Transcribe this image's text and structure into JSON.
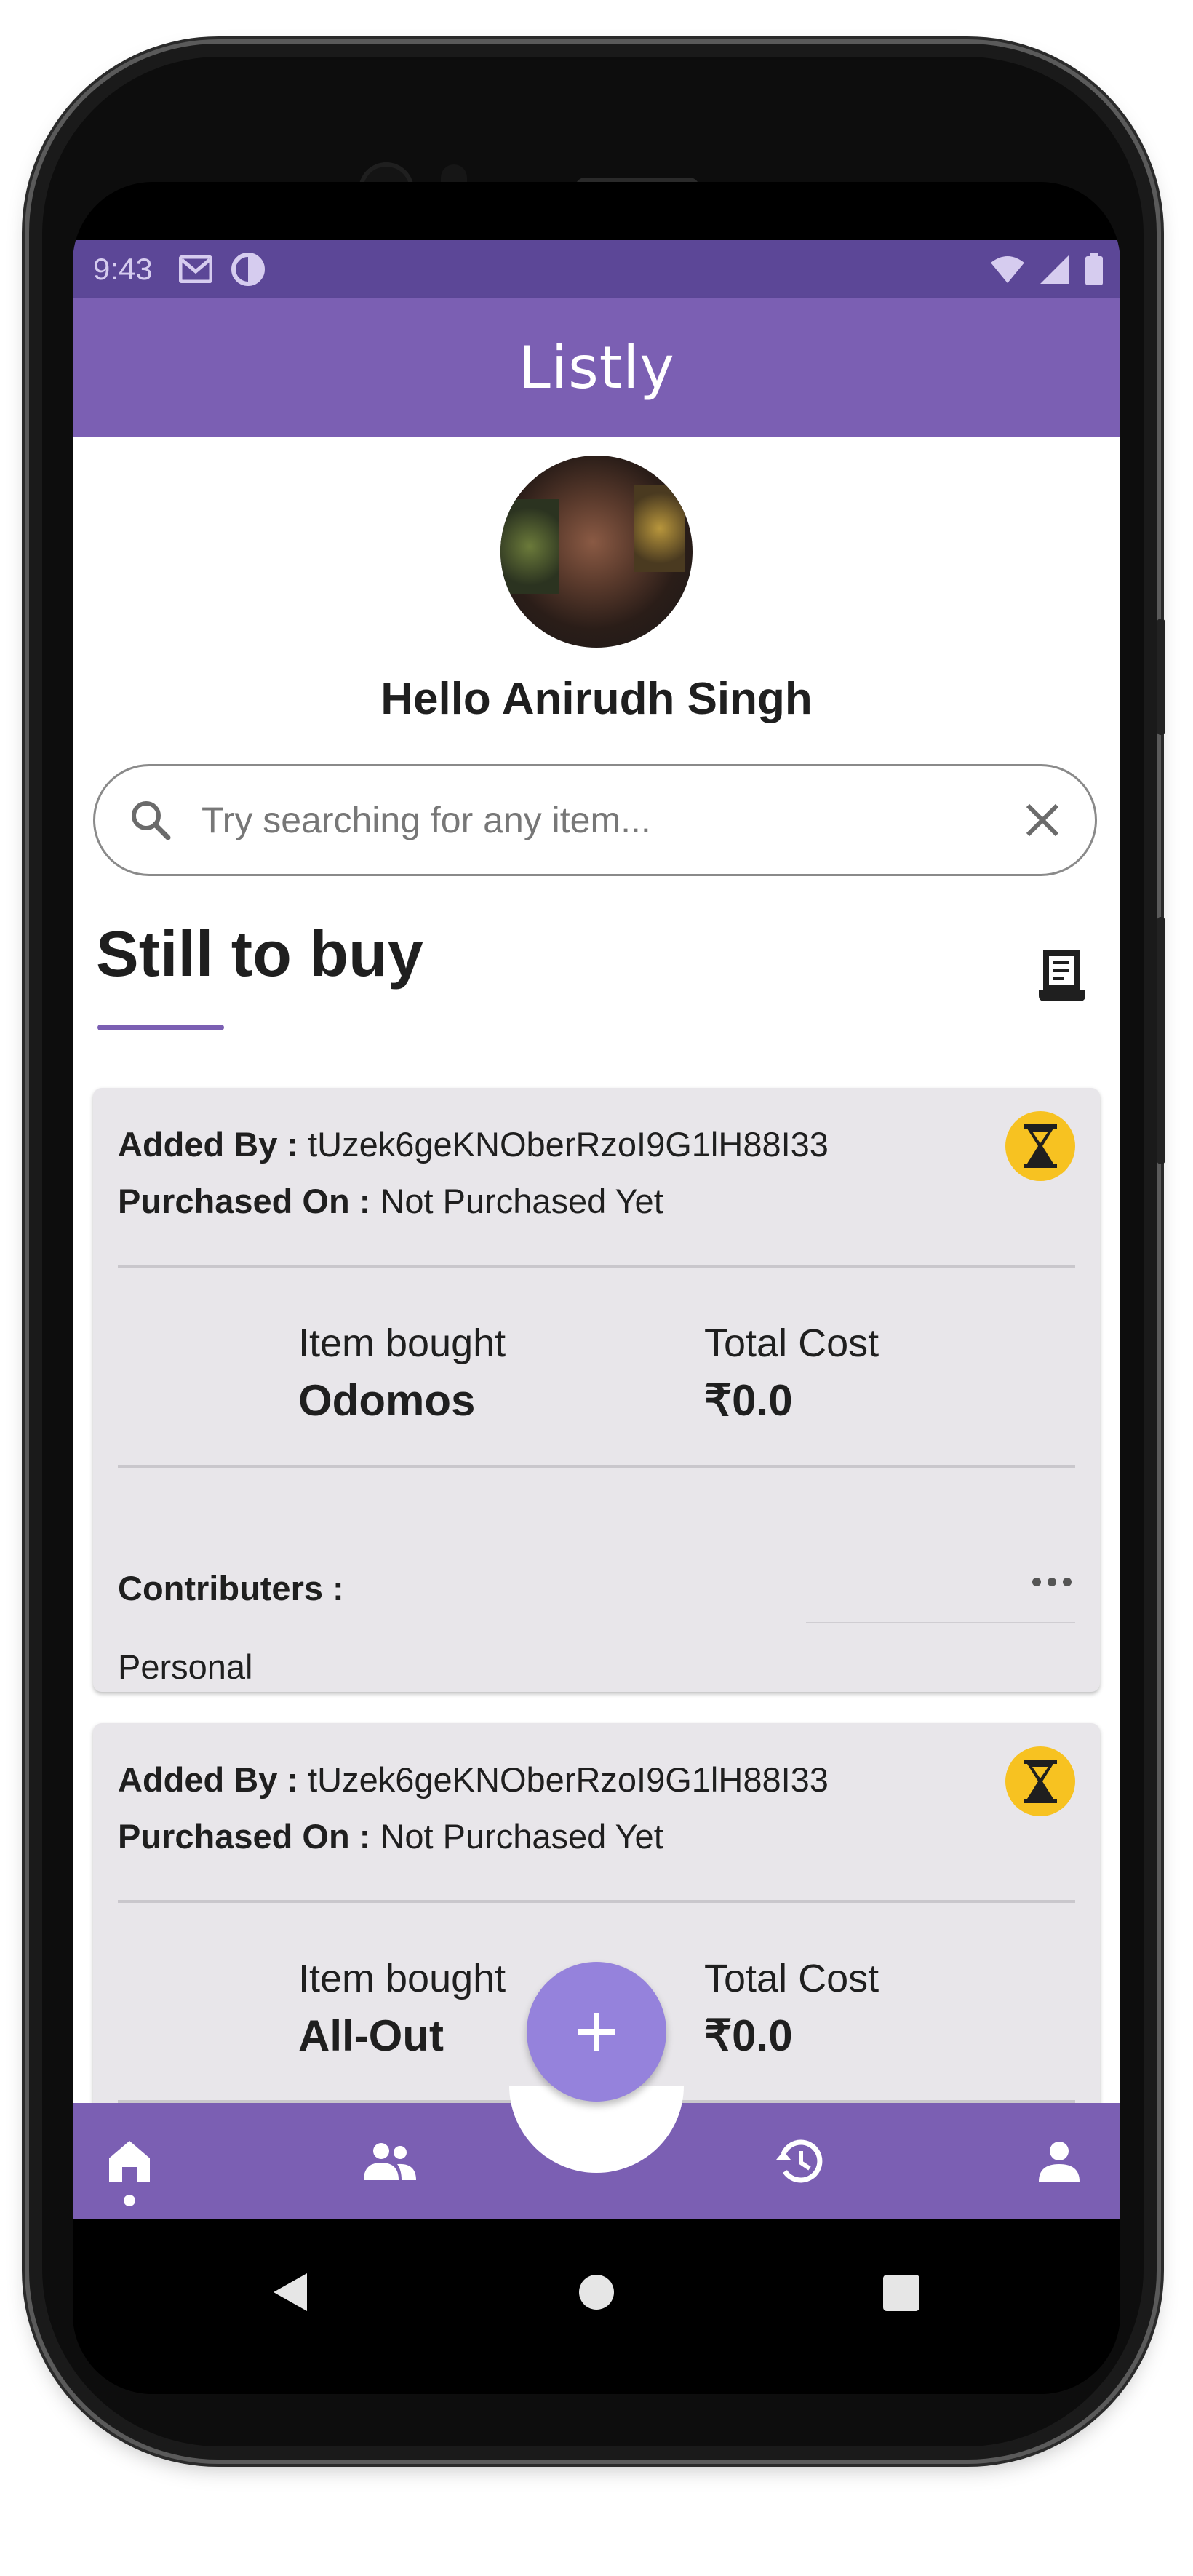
{
  "status_bar": {
    "time": "9:43",
    "left_icons": [
      "gmail-icon",
      "sync-icon"
    ],
    "right_icons": [
      "wifi-icon",
      "signal-icon",
      "battery-icon"
    ]
  },
  "app_bar": {
    "title": "Listly"
  },
  "profile": {
    "greeting": "Hello Anirudh Singh"
  },
  "search": {
    "placeholder": "Try searching for any item..."
  },
  "section": {
    "title": "Still to buy"
  },
  "labels": {
    "added_by": "Added By :",
    "purchased_on": "Purchased On :",
    "item_bought": "Item bought",
    "total_cost": "Total Cost",
    "contributers": "Contributers :"
  },
  "cards": [
    {
      "added_by": "tUzek6geKNOberRzoI9G1lH88I33",
      "purchased_on": "Not Purchased Yet",
      "item": "Odomos",
      "cost": "₹0.0",
      "contributers": "Personal",
      "status": "pending"
    },
    {
      "added_by": "tUzek6geKNOberRzoI9G1lH88I33",
      "purchased_on": "Not Purchased Yet",
      "item": "All-Out",
      "cost": "₹0.0",
      "status": "pending"
    }
  ],
  "bottom_nav": {
    "items": [
      "home-icon",
      "group-icon",
      "history-icon",
      "profile-icon"
    ],
    "active": "home-icon",
    "fab": "add-icon"
  },
  "colors": {
    "primary": "#7b5fb3",
    "status_bar": "#5c4797",
    "fab": "#9582dc",
    "card": "#e8e6ea",
    "badge": "#f7c221"
  }
}
